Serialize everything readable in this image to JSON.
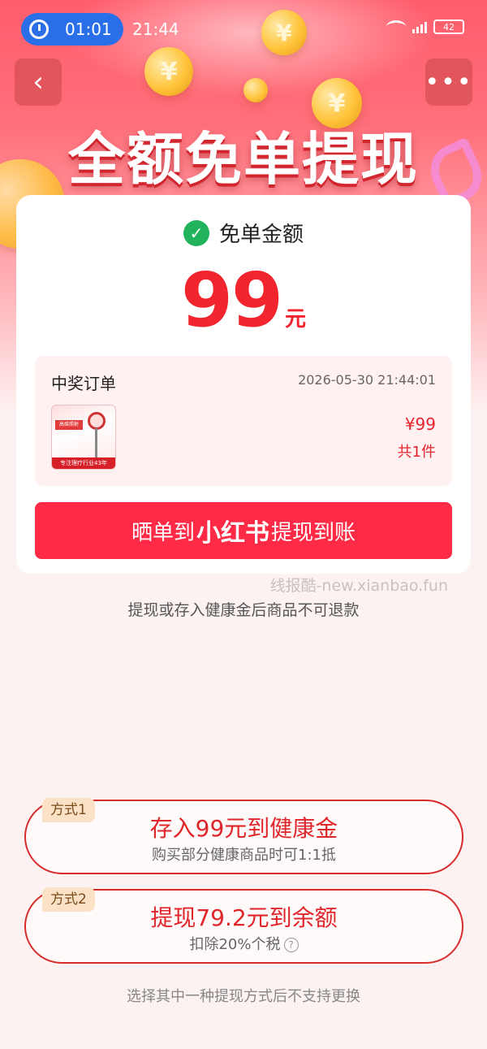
{
  "status_bar": {
    "timer": "01:01",
    "time": "21:44",
    "battery": "42"
  },
  "nav": {
    "back_symbol": "‹",
    "more_symbol": "•••"
  },
  "hero": {
    "title": "全额免单提现",
    "coin_symbol": "¥"
  },
  "card": {
    "amount_label": "免单金额",
    "amount_value": "99",
    "amount_unit": "元",
    "order": {
      "title": "中奖订单",
      "time": "2026-05-30 21:44:01",
      "price": "¥99",
      "count": "共1件",
      "thumb_tag": "高维照射",
      "thumb_band": "专注理疗行业43年"
    },
    "cta": {
      "prefix": "晒单到",
      "brand": "小红书",
      "suffix": "提现到账"
    }
  },
  "watermark": "线报酷-new.xianbao.fun",
  "refund_note": "提现或存入健康金后商品不可退款",
  "options": [
    {
      "tag": "方式1",
      "title": "存入99元到健康金",
      "subtitle": "购买部分健康商品时可1:1抵"
    },
    {
      "tag": "方式2",
      "title": "提现79.2元到余额",
      "subtitle": "扣除20%个税"
    }
  ],
  "help_symbol": "?",
  "bottom_note": "选择其中一种提现方式后不支持更换",
  "colors": {
    "primary_red": "#ff2a45",
    "amount_red": "#f2242e",
    "check_green": "#21b35c",
    "timer_blue": "#2b6fe8"
  }
}
